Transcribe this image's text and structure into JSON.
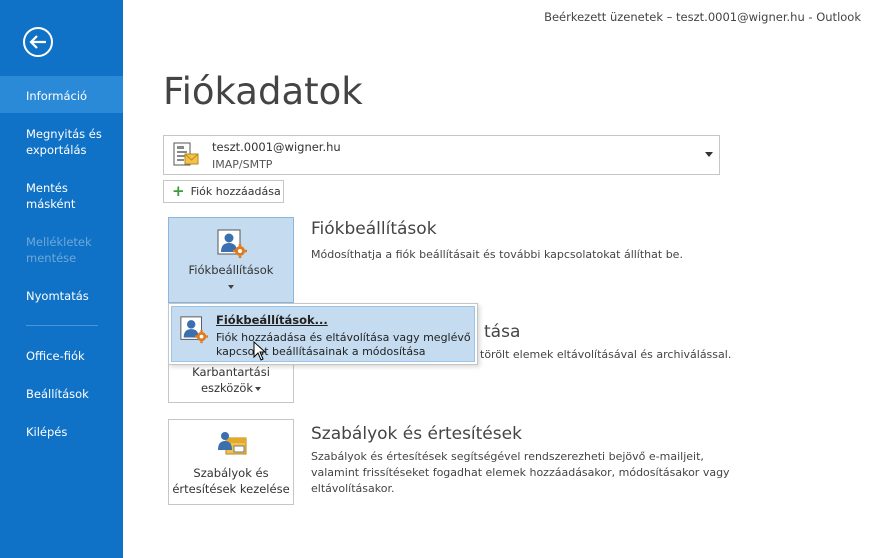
{
  "window": {
    "title": "Beérkezett üzenetek – teszt.0001@wigner.hu - Outlook"
  },
  "sidebar": {
    "items": [
      {
        "label": "Információ",
        "state": "active"
      },
      {
        "label": "Megnyitás és exportálás",
        "state": "normal"
      },
      {
        "label": "Mentés másként",
        "state": "normal"
      },
      {
        "label": "Mellékletek mentése",
        "state": "disabled"
      },
      {
        "label": "Nyomtatás",
        "state": "normal"
      },
      {
        "label": "Office-fiók",
        "state": "normal"
      },
      {
        "label": "Beállítások",
        "state": "normal"
      },
      {
        "label": "Kilépés",
        "state": "normal"
      }
    ]
  },
  "page": {
    "title": "Fiókadatok"
  },
  "account": {
    "email": "teszt.0001@wigner.hu",
    "type": "IMAP/SMTP"
  },
  "add_account": {
    "label": "Fiók hozzáadása"
  },
  "sections": {
    "settings": {
      "tile_label": "Fiókbeállítások",
      "title": "Fiókbeállítások",
      "desc": "Módosíthatja a fiók beállításait és további kapcsolatokat állíthat be."
    },
    "cleanup": {
      "tile_label_1": "Karbantartási",
      "tile_label_2": "eszközök",
      "title_visible": "tása",
      "desc_visible": "törölt elemek eltávolításával és archiválással."
    },
    "rules": {
      "tile_label_1": "Szabályok és",
      "tile_label_2": "értesítések kezelése",
      "title": "Szabályok és értesítések",
      "desc_1": "Szabályok és értesítések segítségével rendszerezheti bejövő e-mailjeit,",
      "desc_2": "valamint frissítéseket fogadhat elemek hozzáadásakor, módosításakor vagy",
      "desc_3": "eltávolításakor."
    }
  },
  "popup": {
    "title": "Fiókbeállítások...",
    "desc_1": "Fiók hozzáadása és eltávolítása vagy meglévő",
    "desc_2": "kapcsolat beállításainak a módosítása"
  },
  "colors": {
    "sidebar": "#0f72c6",
    "active_item": "#2a8ad8",
    "selected_tile": "#c5dcf0",
    "gear": "#e07a20"
  },
  "icons": [
    "back-arrow-icon",
    "account-icon",
    "dropdown-arrow-icon",
    "plus-icon",
    "account-settings-icon",
    "rules-icon",
    "mouse-cursor-icon"
  ]
}
